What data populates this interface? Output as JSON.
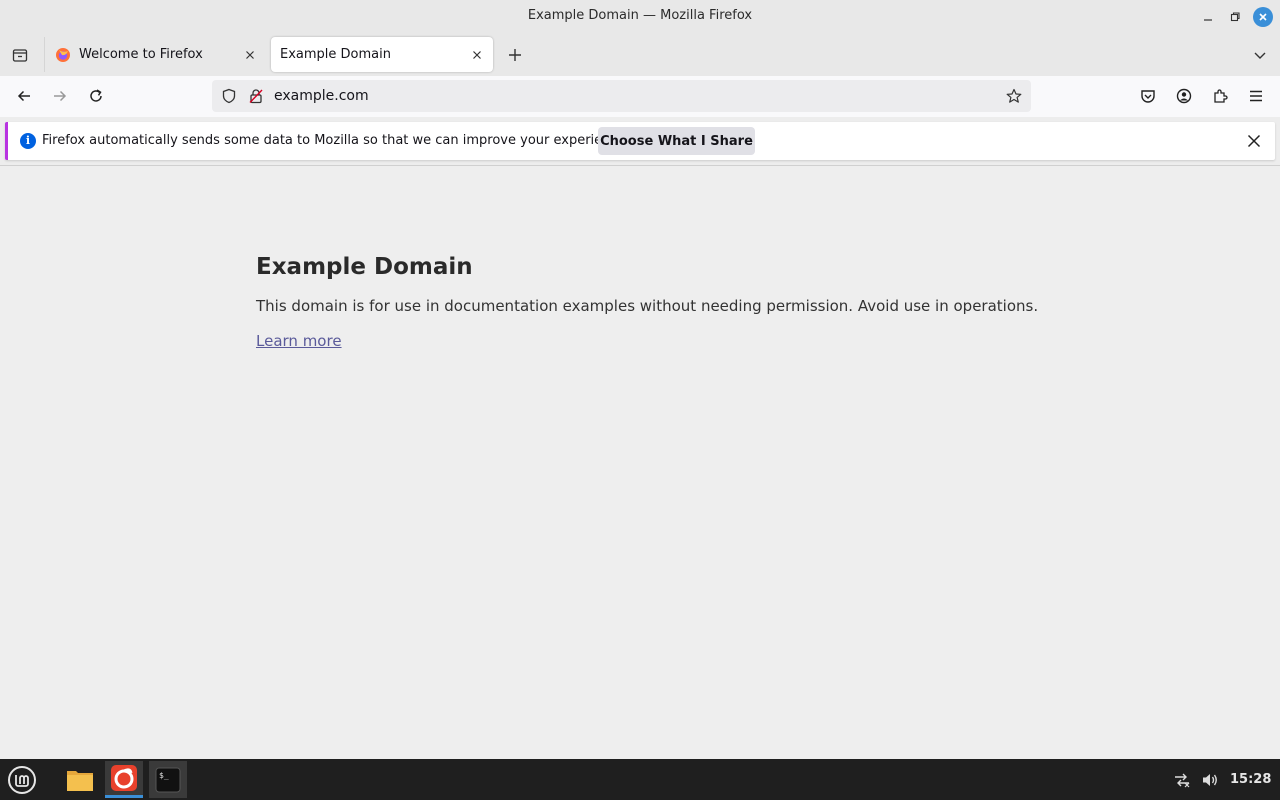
{
  "window": {
    "title": "Example Domain — Mozilla Firefox"
  },
  "tabs": [
    {
      "label": "Welcome to Firefox",
      "icon": "firefox-icon",
      "active": false
    },
    {
      "label": "Example Domain",
      "icon": "",
      "active": true
    }
  ],
  "navbar": {
    "url": "example.com",
    "icons": [
      "back-icon",
      "forward-icon",
      "reload-icon",
      "shield-icon",
      "insecure-lock-icon",
      "bookmark-star-icon",
      "pocket-icon",
      "account-icon",
      "extensions-icon",
      "menu-icon"
    ]
  },
  "notification": {
    "message": "Firefox automatically sends some data to Mozilla so that we can improve your experience.",
    "button_label": "Choose What I Share",
    "accent_color": "#b833e1"
  },
  "page": {
    "heading": "Example Domain",
    "description": "This domain is for use in documentation examples without needing permission. Avoid use in operations.",
    "link": "Learn more"
  },
  "taskbar": {
    "apps": [
      "mint-menu-icon",
      "files-icon",
      "firefox-icon",
      "terminal-icon"
    ],
    "terminal_prompt": "$_",
    "clock": "15:28"
  }
}
